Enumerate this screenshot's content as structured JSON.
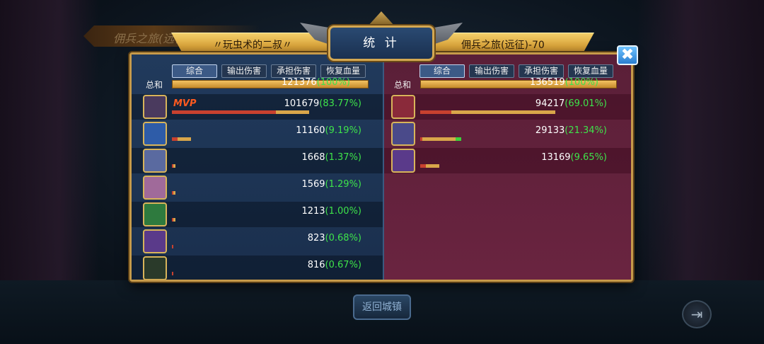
{
  "background": {
    "title": "佣兵之旅(远征)"
  },
  "header": {
    "title": "统 计",
    "left_player": "〃玩虫术的二叔〃",
    "right_player": "佣兵之旅(远征)-70"
  },
  "tabs": [
    "综合",
    "输出伤害",
    "承担伤害",
    "恢复血量"
  ],
  "total_label": "总和",
  "left": {
    "total": "121376",
    "total_pct": "(100%)",
    "rows": [
      {
        "avatar_icon": "dark-haired-hero-icon",
        "color": "#4a3a5e",
        "value": "101679",
        "pct": "(83.77%)",
        "mvp": "MVP",
        "red": 0.53,
        "gold": 0.17
      },
      {
        "avatar_icon": "blue-mage-hero-icon",
        "color": "#2e5ca8",
        "value": "11160",
        "pct": "(9.19%)",
        "mvp": "",
        "red": 0.03,
        "gold": 0.07
      },
      {
        "avatar_icon": "white-hair-hero-icon",
        "color": "#5a6aa0",
        "value": "1668",
        "pct": "(1.37%)",
        "mvp": "",
        "red": 0.0,
        "gold": 0.01
      },
      {
        "avatar_icon": "blonde-hero-icon",
        "color": "#a06a9a",
        "value": "1569",
        "pct": "(1.29%)",
        "mvp": "",
        "red": 0.0,
        "gold": 0.01
      },
      {
        "avatar_icon": "green-hero-icon",
        "color": "#2e7a3e",
        "value": "1213",
        "pct": "(1.00%)",
        "mvp": "",
        "red": 0.0,
        "gold": 0.01
      },
      {
        "avatar_icon": "purple-dragon-icon",
        "color": "#5a3a8a",
        "value": "823",
        "pct": "(0.68%)",
        "mvp": "",
        "red": 0.0,
        "gold": 0.005
      },
      {
        "avatar_icon": "dark-beast-icon",
        "color": "#2a3a2a",
        "value": "816",
        "pct": "(0.67%)",
        "mvp": "",
        "red": 0.0,
        "gold": 0.005
      }
    ]
  },
  "right": {
    "total": "136519",
    "total_pct": "(100%)",
    "rows": [
      {
        "avatar_icon": "red-demon-icon",
        "color": "#8a2a3a",
        "value": "94217",
        "pct": "(69.01%)",
        "red": 0.16,
        "gold": 0.53,
        "green": 0.0
      },
      {
        "avatar_icon": "armored-dragon-icon",
        "color": "#4a4a8a",
        "value": "29133",
        "pct": "(21.34%)",
        "red": 0.01,
        "gold": 0.17,
        "green": 0.03
      },
      {
        "avatar_icon": "purple-dragon-icon",
        "color": "#5a3a8a",
        "value": "13169",
        "pct": "(9.65%)",
        "red": 0.03,
        "gold": 0.07,
        "green": 0.0
      }
    ]
  },
  "buttons": {
    "home": "返回城镇",
    "close": "✖",
    "exit": "⇥"
  }
}
